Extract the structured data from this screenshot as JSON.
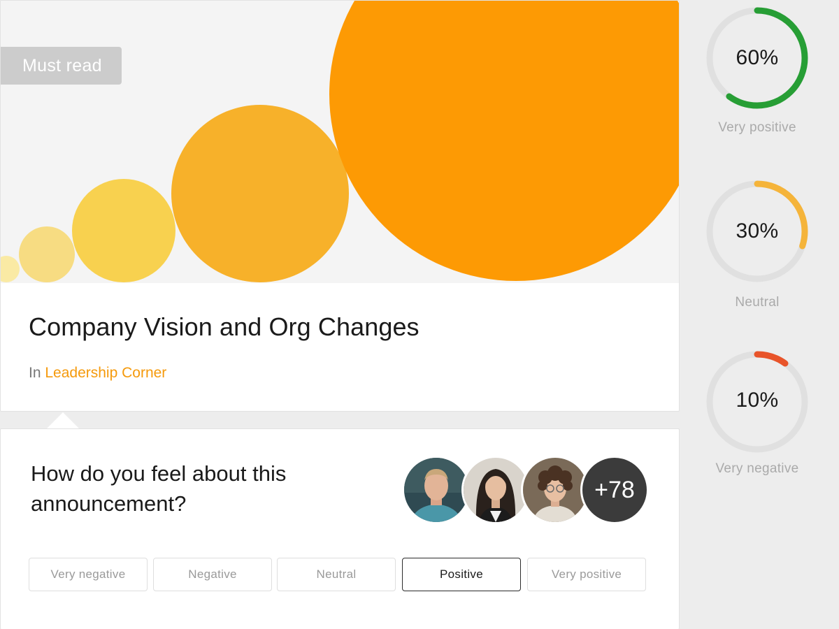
{
  "announcement": {
    "badge": "Must read",
    "title": "Company Vision and Org Changes",
    "in_label": "In",
    "channel": "Leadership Corner"
  },
  "feedback": {
    "question": "How do you feel about this announcement?",
    "avatars_more": "+78",
    "options": [
      {
        "label": "Very negative",
        "selected": false
      },
      {
        "label": "Negative",
        "selected": false
      },
      {
        "label": "Neutral",
        "selected": false
      },
      {
        "label": "Positive",
        "selected": true
      },
      {
        "label": "Very positive",
        "selected": false
      }
    ]
  },
  "sentiments": [
    {
      "percent_text": "60%",
      "value": 0.6,
      "label": "Very positive",
      "color": "#279e35"
    },
    {
      "percent_text": "30%",
      "value": 0.3,
      "label": "Neutral",
      "color": "#f5b43a"
    },
    {
      "percent_text": "10%",
      "value": 0.1,
      "label": "Very negative",
      "color": "#e8542a"
    }
  ],
  "colors": {
    "accent": "#f59a0c",
    "ring_track": "#e0e0e0"
  }
}
